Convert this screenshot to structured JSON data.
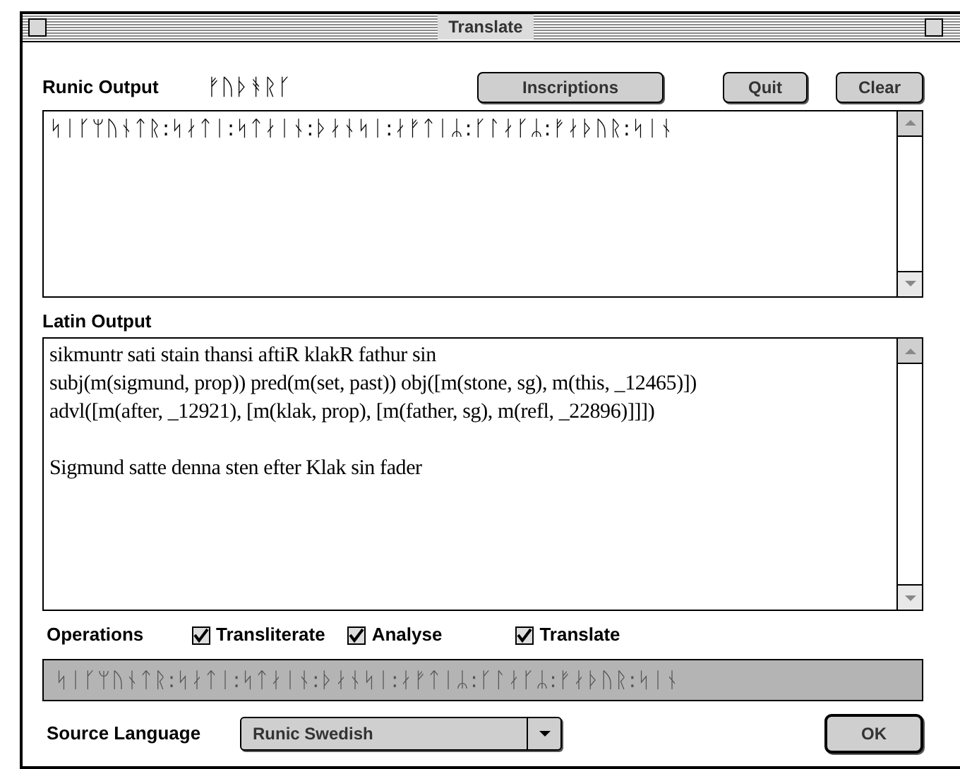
{
  "window": {
    "title": "Translate"
  },
  "runic_output": {
    "label": "Runic Output",
    "alphabet": "ᚠᚢᚦᚬᚱᚴ",
    "text": "ᛋᛁᚴᛘᚢᚾᛏᚱ:ᛋᛅᛏᛁ:ᛋᛏᛅᛁᚾ:ᚦᛅᚾᛋᛁ:ᛅᚠᛏᛁᛦ:ᚴᛚᛅᚴᛦ:ᚠᛅᚦᚢᚱ:ᛋᛁᚾ"
  },
  "buttons": [
    "Inscriptions",
    "Quit",
    "Clear"
  ],
  "latin_output": {
    "label": "Latin Output",
    "lines": [
      "sikmuntr sati stain thansi aftiR klakR fathur sin",
      "subj(m(sigmund, prop)) pred(m(set, past)) obj([m(stone, sg), m(this, _12465)])",
      "advl([m(after, _12921), [m(klak, prop), [m(father, sg), m(refl, _22896)]]])"
    ],
    "translation": "Sigmund satte denna sten efter Klak sin fader"
  },
  "operations": {
    "label": "Operations",
    "options": [
      {
        "label": "Transliterate",
        "checked": true
      },
      {
        "label": "Analyse",
        "checked": true
      },
      {
        "label": "Translate",
        "checked": true
      }
    ]
  },
  "input": {
    "value": "ᛋᛁᚴᛘᚢᚾᛏᚱ:ᛋᛅᛏᛁ:ᛋᛏᛅᛁᚾ:ᚦᛅᚾᛋᛁ:ᛅᚠᛏᛁᛦ:ᚴᛚᛅᚴᛦ:ᚠᛅᚦᚢᚱ:ᛋᛁᚾ",
    "disabled": true
  },
  "source_language": {
    "label": "Source Language",
    "value": "Runic Swedish"
  },
  "ok_button": "OK"
}
